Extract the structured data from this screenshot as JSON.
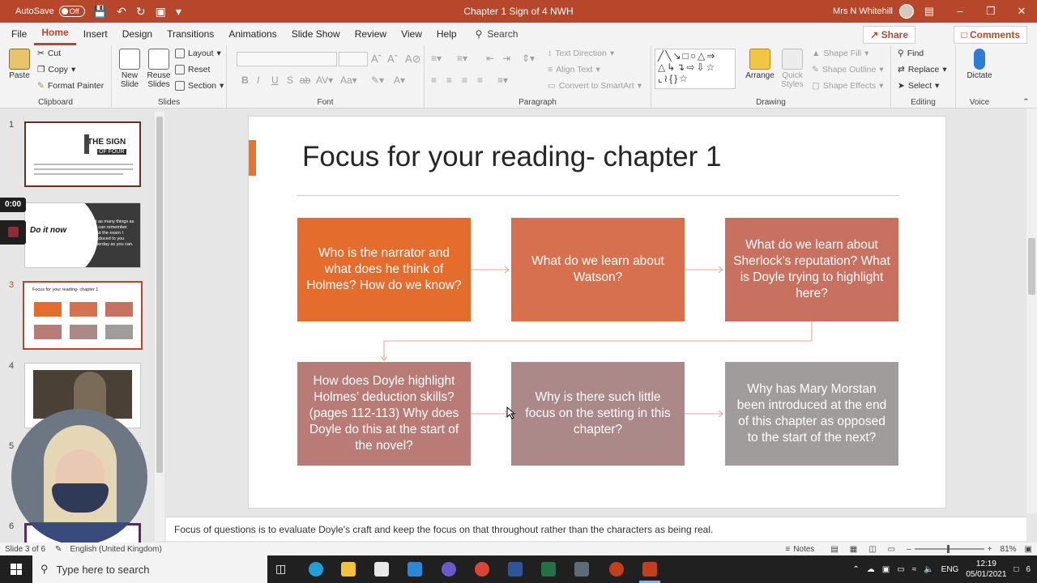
{
  "titlebar": {
    "autosave": "AutoSave",
    "toggle": "Off",
    "doc_title": "Chapter 1 Sign of 4 NWH",
    "user": "Mrs N Whitehill"
  },
  "menu": {
    "tabs": [
      "File",
      "Home",
      "Insert",
      "Design",
      "Transitions",
      "Animations",
      "Slide Show",
      "Review",
      "View",
      "Help"
    ],
    "active": "Home",
    "search": "Search",
    "share": "Share",
    "comments": "Comments"
  },
  "ribbon": {
    "clipboard": {
      "label": "Clipboard",
      "paste": "Paste",
      "cut": "Cut",
      "copy": "Copy",
      "format_painter": "Format Painter"
    },
    "slides": {
      "label": "Slides",
      "new_slide": "New Slide",
      "reuse_slides": "Reuse Slides",
      "layout": "Layout",
      "reset": "Reset",
      "section": "Section"
    },
    "font": {
      "label": "Font"
    },
    "paragraph": {
      "label": "Paragraph",
      "text_direction": "Text Direction",
      "align_text": "Align Text",
      "convert_smartart": "Convert to SmartArt"
    },
    "drawing": {
      "label": "Drawing",
      "arrange": "Arrange",
      "quick_styles": "Quick Styles",
      "shape_fill": "Shape Fill",
      "shape_outline": "Shape Outline",
      "shape_effects": "Shape Effects"
    },
    "editing": {
      "label": "Editing",
      "find": "Find",
      "replace": "Replace",
      "select": "Select"
    },
    "voice": {
      "label": "Voice",
      "dictate": "Dictate"
    }
  },
  "thumbs": {
    "numbers": [
      "1",
      "3",
      "4",
      "5",
      "6"
    ],
    "current": "3",
    "timer": "0:00",
    "slide2_title": "Do it now",
    "slide2_text": "List as many things as you can remember about the exam I introduced to you yesterday as you can.",
    "slide1_title": "THE SIGN",
    "slide1_sub": "OF FOUR",
    "slide3_title": "Focus for your reading- chapter 1"
  },
  "slide": {
    "title": "Focus for your reading- chapter 1",
    "boxes": [
      {
        "text": "Who is the narrator and what does he think of Holmes?  How do we know?",
        "color": "#e46c2d"
      },
      {
        "text": "What do we learn about Watson?",
        "color": "#d7704e"
      },
      {
        "text": "What do we learn about Sherlock’s reputation? What is Doyle trying to highlight here?",
        "color": "#c87160"
      },
      {
        "text": "How does Doyle highlight Holmes’ deduction skills? (pages 112-113)  Why does Doyle do this at the start of the novel?",
        "color": "#b97b76"
      },
      {
        "text": "Why is there such little focus on the setting in this chapter?",
        "color": "#ab8988"
      },
      {
        "text": "Why has Mary Morstan been introduced at the end of this chapter as opposed to the start of the next?",
        "color": "#a09c9b"
      }
    ]
  },
  "notes": "Focus of questions is to evaluate Doyle's craft and keep the focus on that throughout rather than the characters as being real.",
  "status": {
    "slide_of": "Slide 3 of 6",
    "language": "English (United Kingdom)",
    "notes": "Notes",
    "zoom": "81%"
  },
  "taskbar": {
    "search": "Type here to search",
    "lang": "ENG",
    "time": "12:19",
    "date": "05/01/2021",
    "notif": "6"
  }
}
